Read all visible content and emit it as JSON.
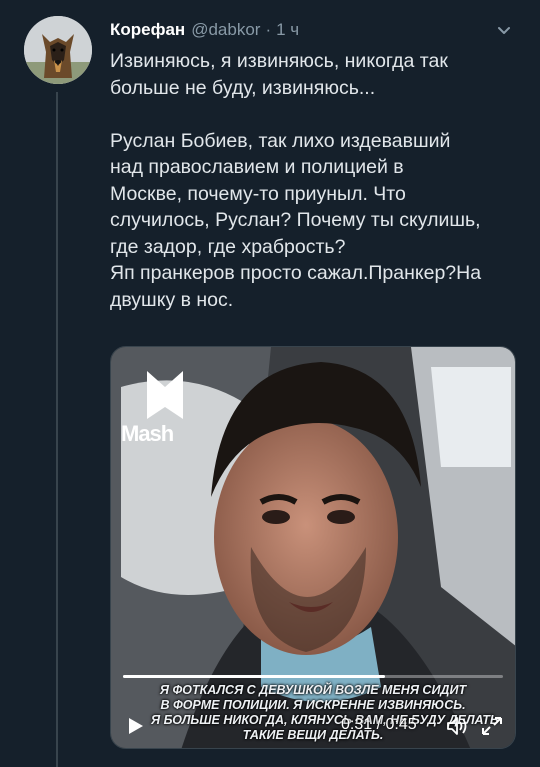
{
  "author": {
    "display_name": "Корефан",
    "handle": "@dabkor",
    "separator": "·",
    "time": "1 ч"
  },
  "tweet": {
    "paragraphs": [
      [
        "Извиняюсь, я извиняюсь, никогда так",
        "больше не буду, извиняюсь..."
      ],
      [
        "Руслан Бобиев, так лихо издевавший",
        "над православием и полицией в",
        "Москве, почему-то приуныл. Что",
        "случилось, Руслан? Почему ты скулишь,",
        "где задор, где храбрость?",
        "Яп пранкеров просто сажал.Пранкер?На",
        "двушку в нос."
      ]
    ]
  },
  "video": {
    "watermark": "Mash",
    "subtitles": [
      "Я ФОТКАЛСЯ С ДЕВУШКОЙ ВОЗЛЕ МЕНЯ СИДИТ",
      "В ФОРМЕ ПОЛИЦИИ. Я ИСКРЕННЕ ИЗВИНЯЮСЬ.",
      "Я БОЛЬШЕ НИКОГДА, КЛЯНУСЬ ВАМ, НЕ БУДУ ДЕЛАТЬ",
      "ТАКИЕ ВЕЩИ ДЕЛАТЬ."
    ],
    "current_time": "0:31",
    "duration": "0:45",
    "time_separator": " / ",
    "progress": 0.69
  },
  "colors": {
    "background": "#15202b",
    "secondary_text": "#8899a6",
    "primary_text": "#e1e6ea"
  },
  "icons": {
    "more": "more-chevron-icon",
    "play": "play-icon",
    "volume": "volume-icon",
    "fullscreen": "fullscreen-icon"
  }
}
